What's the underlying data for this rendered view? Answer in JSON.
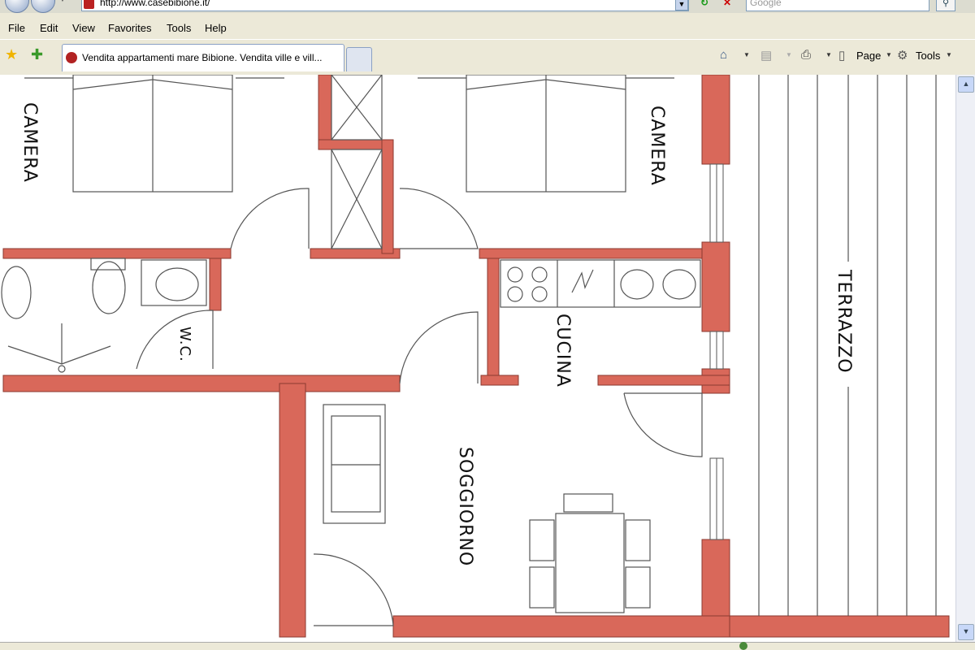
{
  "browser": {
    "address_url": "http://www.casebibione.it/",
    "search_placeholder": "Google",
    "menu": [
      "File",
      "Edit",
      "View",
      "Favorites",
      "Tools",
      "Help"
    ],
    "tab_title": "Vendita appartamenti mare Bibione. Vendita ville e vill...",
    "commands": {
      "page": "Page",
      "tools": "Tools"
    },
    "icons": {
      "favorites": "favorites-star-icon",
      "add_favorites": "add-favorites-icon",
      "home": "home-icon",
      "feeds": "rss-feed-icon",
      "print": "print-icon",
      "page": "page-icon",
      "tools": "gear-icon"
    }
  },
  "floorplan": {
    "rooms": {
      "camera_left": "CAMERA",
      "camera_right": "CAMERA",
      "wc": "W.C.",
      "cucina": "CUCINA",
      "soggiorno": "SOGGIORNO",
      "terrazzo": "TERRAZZO"
    },
    "colors": {
      "wall": "#d9685a",
      "line": "#555555",
      "background": "#ffffff"
    }
  }
}
